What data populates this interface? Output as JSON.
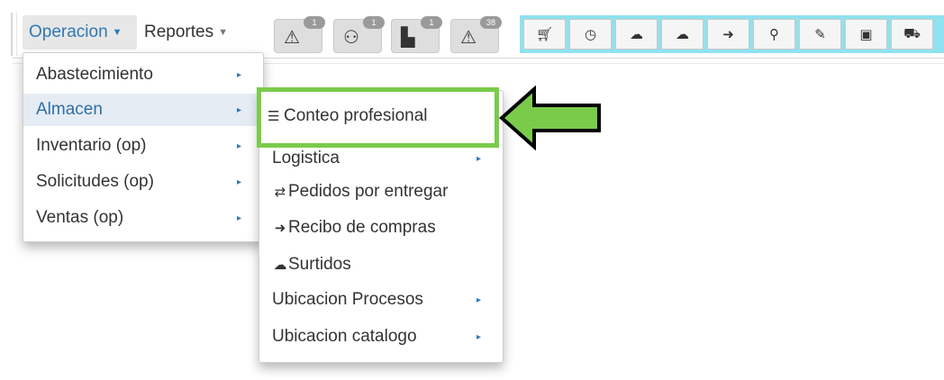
{
  "nav": {
    "operacion_label": "Operacion",
    "reportes_label": "Reportes"
  },
  "alerts": [
    {
      "icon": "warning-icon",
      "badge": "1"
    },
    {
      "icon": "users-icon",
      "badge": "1"
    },
    {
      "icon": "building-icon",
      "badge": "1"
    },
    {
      "icon": "warning-icon",
      "badge": "38"
    }
  ],
  "toolbar": [
    {
      "icon": "cart-icon"
    },
    {
      "icon": "clock-icon"
    },
    {
      "icon": "cloud-upload-icon"
    },
    {
      "icon": "cloud-download-icon"
    },
    {
      "icon": "login-icon"
    },
    {
      "icon": "map-marker-icon"
    },
    {
      "icon": "edit-icon"
    },
    {
      "icon": "safe-icon"
    },
    {
      "icon": "car-icon"
    }
  ],
  "menu_operacion": {
    "items": [
      {
        "label": "Abastecimiento"
      },
      {
        "label": "Almacen"
      },
      {
        "label": "Inventario (op)"
      },
      {
        "label": "Solicitudes (op)"
      },
      {
        "label": "Ventas (op)"
      }
    ]
  },
  "menu_almacen": {
    "items": [
      {
        "label": "Conteo profesional",
        "icon": "database-icon"
      },
      {
        "label": "Logistica"
      },
      {
        "label": "Pedidos por entregar",
        "icon": "transfer-icon"
      },
      {
        "label": "Recibo de compras",
        "icon": "login-icon"
      },
      {
        "label": "Surtidos",
        "icon": "cloud-upload-icon"
      },
      {
        "label": "Ubicacion Procesos"
      },
      {
        "label": "Ubicacion catalogo"
      }
    ]
  },
  "colors": {
    "highlight": "#7acb4a",
    "toolbar_bg": "#8fe2f0",
    "link": "#2f78b7"
  }
}
